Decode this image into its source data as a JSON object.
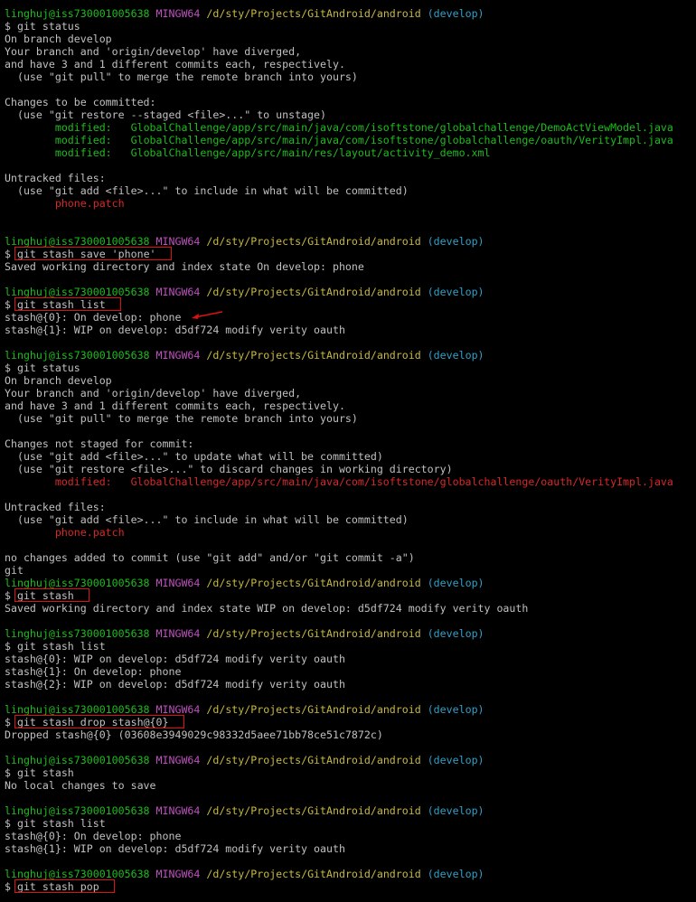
{
  "theme": {
    "background": "#000000",
    "text": "#c0c0c0",
    "prompt_user": "#1cbd1c",
    "prompt_system": "#c050c0",
    "prompt_path": "#c8b840",
    "prompt_branch": "#32a0c8",
    "error_red": "#d82828",
    "annotation_box": "#e01010"
  },
  "prompt": {
    "user_host": "linghuj@iss730001005638",
    "system": "MINGW64",
    "path": "/d/sty/Projects/GitAndroid/android",
    "branch": "(develop)"
  },
  "lines": [
    {
      "t": "prompt"
    },
    {
      "t": "text",
      "s": "$ git status"
    },
    {
      "t": "text",
      "s": "On branch develop"
    },
    {
      "t": "text",
      "s": "Your branch and 'origin/develop' have diverged,"
    },
    {
      "t": "text",
      "s": "and have 3 and 1 different commits each, respectively."
    },
    {
      "t": "text",
      "s": "  (use \"git pull\" to merge the remote branch into yours)"
    },
    {
      "t": "blank"
    },
    {
      "t": "text",
      "s": "Changes to be committed:"
    },
    {
      "t": "text",
      "s": "  (use \"git restore --staged <file>...\" to unstage)"
    },
    {
      "t": "mod",
      "color": "modgreen",
      "label": "modified:   ",
      "path": "GlobalChallenge/app/src/main/java/com/isoftstone/globalchallenge/DemoActViewModel.java"
    },
    {
      "t": "mod",
      "color": "modgreen",
      "label": "modified:   ",
      "path": "GlobalChallenge/app/src/main/java/com/isoftstone/globalchallenge/oauth/VerityImpl.java"
    },
    {
      "t": "mod",
      "color": "modgreen",
      "label": "modified:   ",
      "path": "GlobalChallenge/app/src/main/res/layout/activity_demo.xml"
    },
    {
      "t": "blank"
    },
    {
      "t": "text",
      "s": "Untracked files:"
    },
    {
      "t": "text",
      "s": "  (use \"git add <file>...\" to include in what will be committed)"
    },
    {
      "t": "file",
      "color": "red",
      "s": "phone.patch"
    },
    {
      "t": "blank"
    },
    {
      "t": "blank"
    },
    {
      "t": "prompt"
    },
    {
      "t": "cmd",
      "s": "git stash save 'phone'",
      "box": true
    },
    {
      "t": "text",
      "s": "Saved working directory and index state On develop: phone"
    },
    {
      "t": "blank"
    },
    {
      "t": "prompt"
    },
    {
      "t": "cmd",
      "s": "git stash list",
      "box": true
    },
    {
      "t": "text",
      "s": "stash@{0}: On develop: phone",
      "arrow": true
    },
    {
      "t": "text",
      "s": "stash@{1}: WIP on develop: d5df724 modify verity oauth"
    },
    {
      "t": "blank"
    },
    {
      "t": "prompt"
    },
    {
      "t": "text",
      "s": "$ git status"
    },
    {
      "t": "text",
      "s": "On branch develop"
    },
    {
      "t": "text",
      "s": "Your branch and 'origin/develop' have diverged,"
    },
    {
      "t": "text",
      "s": "and have 3 and 1 different commits each, respectively."
    },
    {
      "t": "text",
      "s": "  (use \"git pull\" to merge the remote branch into yours)"
    },
    {
      "t": "blank"
    },
    {
      "t": "text",
      "s": "Changes not staged for commit:"
    },
    {
      "t": "text",
      "s": "  (use \"git add <file>...\" to update what will be committed)"
    },
    {
      "t": "text",
      "s": "  (use \"git restore <file>...\" to discard changes in working directory)"
    },
    {
      "t": "mod",
      "color": "red",
      "label": "modified:   ",
      "path": "GlobalChallenge/app/src/main/java/com/isoftstone/globalchallenge/oauth/VerityImpl.java"
    },
    {
      "t": "blank"
    },
    {
      "t": "text",
      "s": "Untracked files:"
    },
    {
      "t": "text",
      "s": "  (use \"git add <file>...\" to include in what will be committed)"
    },
    {
      "t": "file",
      "color": "red",
      "s": "phone.patch"
    },
    {
      "t": "blank"
    },
    {
      "t": "text",
      "s": "no changes added to commit (use \"git add\" and/or \"git commit -a\")"
    },
    {
      "t": "text",
      "s": "git"
    },
    {
      "t": "prompt"
    },
    {
      "t": "cmd",
      "s": "git stash",
      "box": true
    },
    {
      "t": "text",
      "s": "Saved working directory and index state WIP on develop: d5df724 modify verity oauth"
    },
    {
      "t": "blank"
    },
    {
      "t": "prompt"
    },
    {
      "t": "text",
      "s": "$ git stash list"
    },
    {
      "t": "text",
      "s": "stash@{0}: WIP on develop: d5df724 modify verity oauth"
    },
    {
      "t": "text",
      "s": "stash@{1}: On develop: phone"
    },
    {
      "t": "text",
      "s": "stash@{2}: WIP on develop: d5df724 modify verity oauth"
    },
    {
      "t": "blank"
    },
    {
      "t": "prompt"
    },
    {
      "t": "cmd",
      "s": "git stash drop stash@{0}",
      "box": true
    },
    {
      "t": "text",
      "s": "Dropped stash@{0} (03608e3949029c98332d5aee71bb78ce51c7872c)"
    },
    {
      "t": "blank"
    },
    {
      "t": "prompt"
    },
    {
      "t": "text",
      "s": "$ git stash"
    },
    {
      "t": "text",
      "s": "No local changes to save"
    },
    {
      "t": "blank"
    },
    {
      "t": "prompt"
    },
    {
      "t": "text",
      "s": "$ git stash list"
    },
    {
      "t": "text",
      "s": "stash@{0}: On develop: phone"
    },
    {
      "t": "text",
      "s": "stash@{1}: WIP on develop: d5df724 modify verity oauth"
    },
    {
      "t": "blank"
    },
    {
      "t": "prompt"
    },
    {
      "t": "cmd",
      "s": "git stash pop",
      "box": true
    }
  ]
}
